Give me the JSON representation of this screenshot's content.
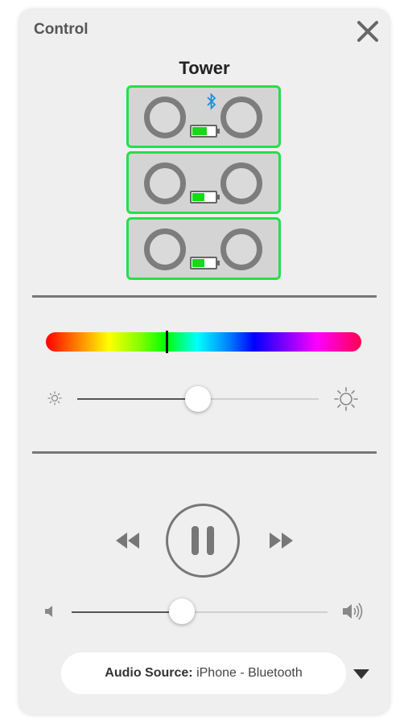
{
  "header": {
    "title": "Control"
  },
  "device": {
    "name": "Tower",
    "speakers": [
      {
        "battery_level": 0.65,
        "bluetooth": true
      },
      {
        "battery_level": 0.55,
        "bluetooth": false
      },
      {
        "battery_level": 0.55,
        "bluetooth": false
      }
    ]
  },
  "lighting": {
    "hue_position": 0.38,
    "brightness_level": 0.5
  },
  "playback": {
    "state": "playing",
    "volume_level": 0.43
  },
  "audio_source": {
    "label": "Audio Source:",
    "value": "iPhone - Bluetooth"
  },
  "colors": {
    "accent_green": "#22e04a",
    "battery_fill": "#18d818",
    "bluetooth_blue": "#1e8fd8"
  }
}
